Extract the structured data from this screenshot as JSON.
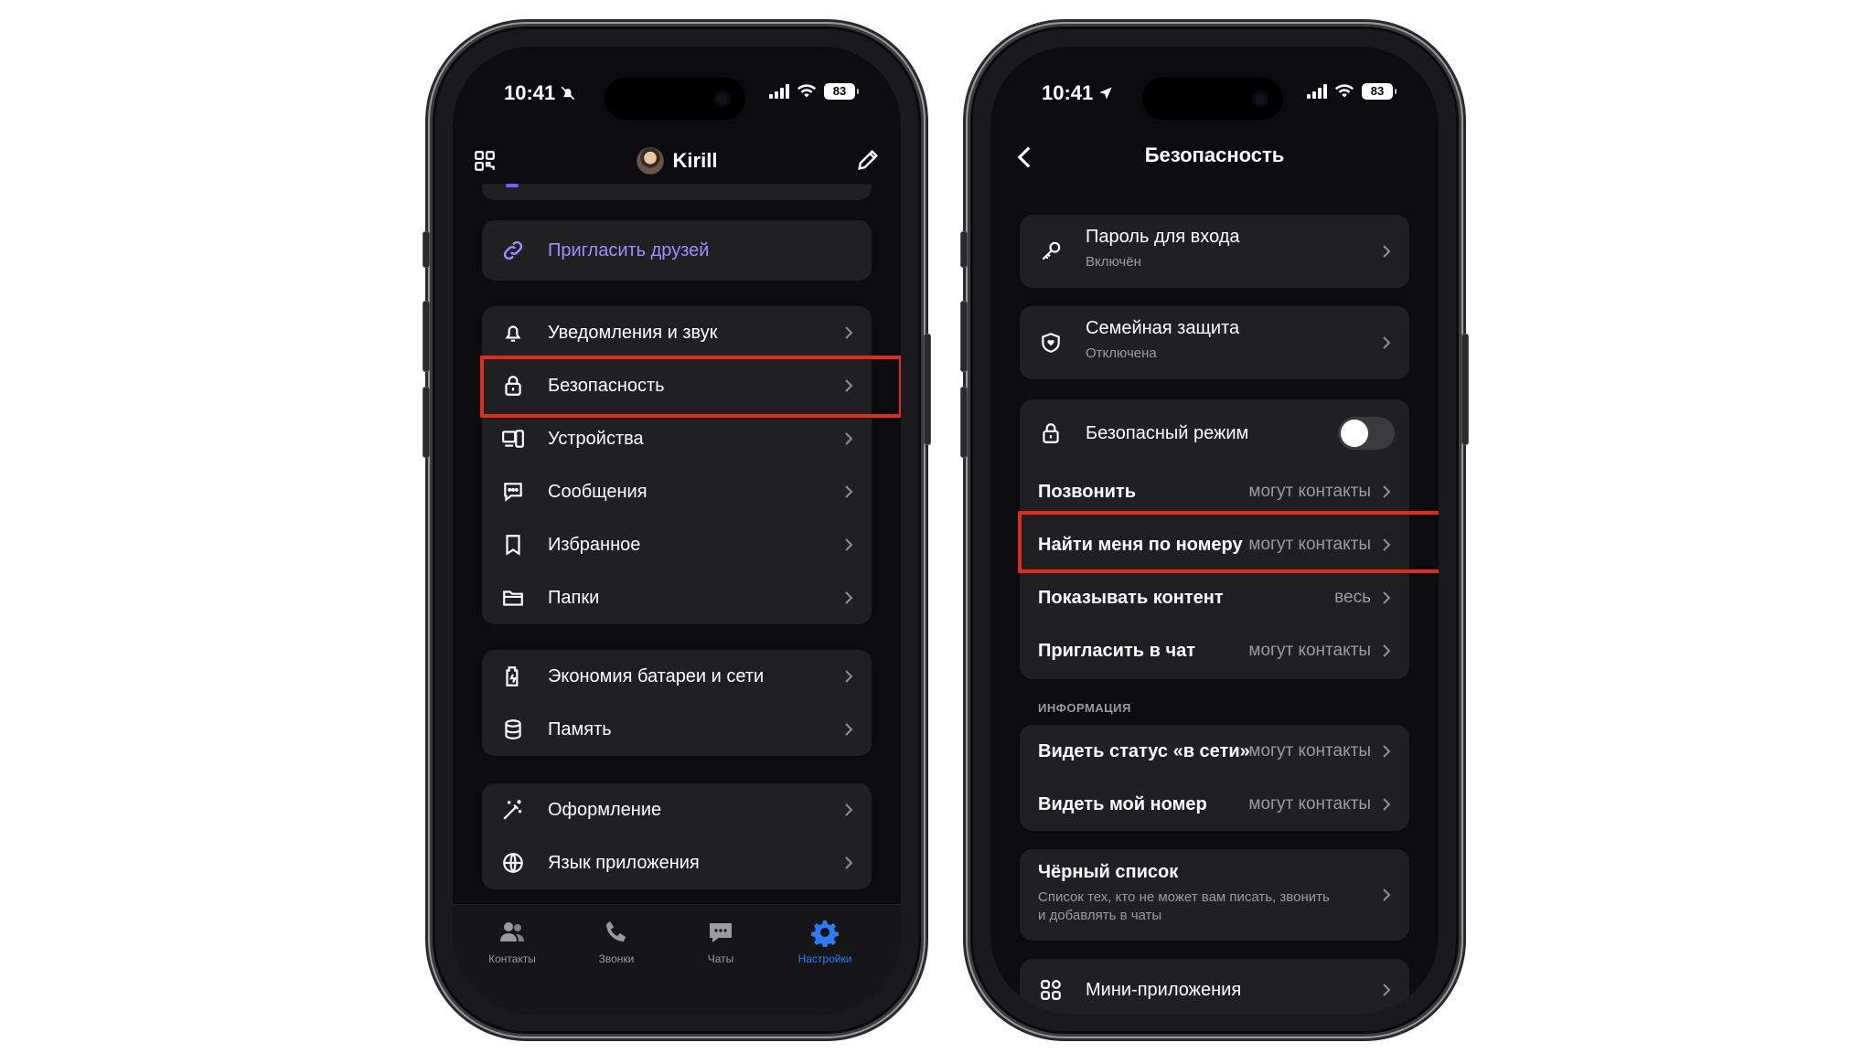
{
  "left": {
    "status": {
      "time": "10:41",
      "battery": "83"
    },
    "header": {
      "title": "Kirill"
    },
    "invite": {
      "label": "Пригласить друзей"
    },
    "group1": [
      {
        "label": "Уведомления и звук",
        "icon": "bell-icon"
      },
      {
        "label": "Безопасность",
        "icon": "lock-icon"
      },
      {
        "label": "Устройства",
        "icon": "devices-icon"
      },
      {
        "label": "Сообщения",
        "icon": "message-icon"
      },
      {
        "label": "Избранное",
        "icon": "bookmark-icon"
      },
      {
        "label": "Папки",
        "icon": "folder-icon"
      }
    ],
    "group2": [
      {
        "label": "Экономия батареи и сети",
        "icon": "battery-saver-icon"
      },
      {
        "label": "Память",
        "icon": "database-icon"
      }
    ],
    "group3": [
      {
        "label": "Оформление",
        "icon": "magic-wand-icon"
      },
      {
        "label": "Язык приложения",
        "icon": "globe-icon"
      }
    ],
    "tabs": [
      {
        "label": "Контакты",
        "icon": "contacts-icon"
      },
      {
        "label": "Звонки",
        "icon": "phone-icon"
      },
      {
        "label": "Чаты",
        "icon": "chat-icon"
      },
      {
        "label": "Настройки",
        "icon": "gear-icon"
      }
    ]
  },
  "right": {
    "status": {
      "time": "10:41",
      "battery": "83"
    },
    "header": {
      "title": "Безопасность"
    },
    "password": {
      "label": "Пароль для входа",
      "sub": "Включён"
    },
    "family": {
      "label": "Семейная защита",
      "sub": "Отключена"
    },
    "safe_mode": {
      "label": "Безопасный режим",
      "enabled": false
    },
    "privacy": [
      {
        "label": "Позвонить",
        "value": "могут контакты"
      },
      {
        "label": "Найти меня по номеру",
        "value": "могут контакты"
      },
      {
        "label": "Показывать контент",
        "value": "весь"
      },
      {
        "label": "Пригласить в чат",
        "value": "могут контакты"
      }
    ],
    "info_caption": "ИНФОРМАЦИЯ",
    "info": [
      {
        "label": "Видеть статус «в сети»",
        "value": "могут контакты"
      },
      {
        "label": "Видеть мой номер",
        "value": "могут контакты"
      }
    ],
    "blacklist": {
      "label": "Чёрный список",
      "sub1": "Список тех, кто не может вам писать, звонить",
      "sub2": "и добавлять в чаты"
    },
    "mini_apps": {
      "label": "Мини-приложения"
    }
  },
  "colors": {
    "accent": "#2f7bf5",
    "invite": "#a08cff",
    "highlight": "#e22b1c",
    "card": "#202023",
    "bg": "#0c0c0e"
  }
}
